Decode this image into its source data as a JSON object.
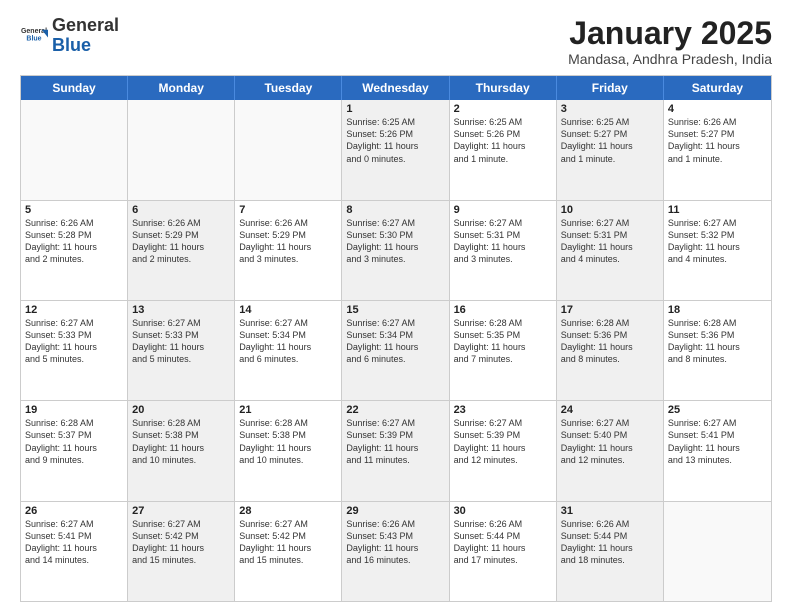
{
  "header": {
    "logo": {
      "general": "General",
      "blue": "Blue"
    },
    "title": "January 2025",
    "location": "Mandasa, Andhra Pradesh, India"
  },
  "calendar": {
    "days": [
      "Sunday",
      "Monday",
      "Tuesday",
      "Wednesday",
      "Thursday",
      "Friday",
      "Saturday"
    ],
    "rows": [
      [
        {
          "num": "",
          "info": "",
          "empty": true
        },
        {
          "num": "",
          "info": "",
          "empty": true
        },
        {
          "num": "",
          "info": "",
          "empty": true
        },
        {
          "num": "1",
          "info": "Sunrise: 6:25 AM\nSunset: 5:26 PM\nDaylight: 11 hours\nand 0 minutes.",
          "shaded": true
        },
        {
          "num": "2",
          "info": "Sunrise: 6:25 AM\nSunset: 5:26 PM\nDaylight: 11 hours\nand 1 minute.",
          "shaded": false
        },
        {
          "num": "3",
          "info": "Sunrise: 6:25 AM\nSunset: 5:27 PM\nDaylight: 11 hours\nand 1 minute.",
          "shaded": true
        },
        {
          "num": "4",
          "info": "Sunrise: 6:26 AM\nSunset: 5:27 PM\nDaylight: 11 hours\nand 1 minute.",
          "shaded": false
        }
      ],
      [
        {
          "num": "5",
          "info": "Sunrise: 6:26 AM\nSunset: 5:28 PM\nDaylight: 11 hours\nand 2 minutes.",
          "shaded": false
        },
        {
          "num": "6",
          "info": "Sunrise: 6:26 AM\nSunset: 5:29 PM\nDaylight: 11 hours\nand 2 minutes.",
          "shaded": true
        },
        {
          "num": "7",
          "info": "Sunrise: 6:26 AM\nSunset: 5:29 PM\nDaylight: 11 hours\nand 3 minutes.",
          "shaded": false
        },
        {
          "num": "8",
          "info": "Sunrise: 6:27 AM\nSunset: 5:30 PM\nDaylight: 11 hours\nand 3 minutes.",
          "shaded": true
        },
        {
          "num": "9",
          "info": "Sunrise: 6:27 AM\nSunset: 5:31 PM\nDaylight: 11 hours\nand 3 minutes.",
          "shaded": false
        },
        {
          "num": "10",
          "info": "Sunrise: 6:27 AM\nSunset: 5:31 PM\nDaylight: 11 hours\nand 4 minutes.",
          "shaded": true
        },
        {
          "num": "11",
          "info": "Sunrise: 6:27 AM\nSunset: 5:32 PM\nDaylight: 11 hours\nand 4 minutes.",
          "shaded": false
        }
      ],
      [
        {
          "num": "12",
          "info": "Sunrise: 6:27 AM\nSunset: 5:33 PM\nDaylight: 11 hours\nand 5 minutes.",
          "shaded": false
        },
        {
          "num": "13",
          "info": "Sunrise: 6:27 AM\nSunset: 5:33 PM\nDaylight: 11 hours\nand 5 minutes.",
          "shaded": true
        },
        {
          "num": "14",
          "info": "Sunrise: 6:27 AM\nSunset: 5:34 PM\nDaylight: 11 hours\nand 6 minutes.",
          "shaded": false
        },
        {
          "num": "15",
          "info": "Sunrise: 6:27 AM\nSunset: 5:34 PM\nDaylight: 11 hours\nand 6 minutes.",
          "shaded": true
        },
        {
          "num": "16",
          "info": "Sunrise: 6:28 AM\nSunset: 5:35 PM\nDaylight: 11 hours\nand 7 minutes.",
          "shaded": false
        },
        {
          "num": "17",
          "info": "Sunrise: 6:28 AM\nSunset: 5:36 PM\nDaylight: 11 hours\nand 8 minutes.",
          "shaded": true
        },
        {
          "num": "18",
          "info": "Sunrise: 6:28 AM\nSunset: 5:36 PM\nDaylight: 11 hours\nand 8 minutes.",
          "shaded": false
        }
      ],
      [
        {
          "num": "19",
          "info": "Sunrise: 6:28 AM\nSunset: 5:37 PM\nDaylight: 11 hours\nand 9 minutes.",
          "shaded": false
        },
        {
          "num": "20",
          "info": "Sunrise: 6:28 AM\nSunset: 5:38 PM\nDaylight: 11 hours\nand 10 minutes.",
          "shaded": true
        },
        {
          "num": "21",
          "info": "Sunrise: 6:28 AM\nSunset: 5:38 PM\nDaylight: 11 hours\nand 10 minutes.",
          "shaded": false
        },
        {
          "num": "22",
          "info": "Sunrise: 6:27 AM\nSunset: 5:39 PM\nDaylight: 11 hours\nand 11 minutes.",
          "shaded": true
        },
        {
          "num": "23",
          "info": "Sunrise: 6:27 AM\nSunset: 5:39 PM\nDaylight: 11 hours\nand 12 minutes.",
          "shaded": false
        },
        {
          "num": "24",
          "info": "Sunrise: 6:27 AM\nSunset: 5:40 PM\nDaylight: 11 hours\nand 12 minutes.",
          "shaded": true
        },
        {
          "num": "25",
          "info": "Sunrise: 6:27 AM\nSunset: 5:41 PM\nDaylight: 11 hours\nand 13 minutes.",
          "shaded": false
        }
      ],
      [
        {
          "num": "26",
          "info": "Sunrise: 6:27 AM\nSunset: 5:41 PM\nDaylight: 11 hours\nand 14 minutes.",
          "shaded": false
        },
        {
          "num": "27",
          "info": "Sunrise: 6:27 AM\nSunset: 5:42 PM\nDaylight: 11 hours\nand 15 minutes.",
          "shaded": true
        },
        {
          "num": "28",
          "info": "Sunrise: 6:27 AM\nSunset: 5:42 PM\nDaylight: 11 hours\nand 15 minutes.",
          "shaded": false
        },
        {
          "num": "29",
          "info": "Sunrise: 6:26 AM\nSunset: 5:43 PM\nDaylight: 11 hours\nand 16 minutes.",
          "shaded": true
        },
        {
          "num": "30",
          "info": "Sunrise: 6:26 AM\nSunset: 5:44 PM\nDaylight: 11 hours\nand 17 minutes.",
          "shaded": false
        },
        {
          "num": "31",
          "info": "Sunrise: 6:26 AM\nSunset: 5:44 PM\nDaylight: 11 hours\nand 18 minutes.",
          "shaded": true
        },
        {
          "num": "",
          "info": "",
          "empty": true
        }
      ]
    ]
  }
}
